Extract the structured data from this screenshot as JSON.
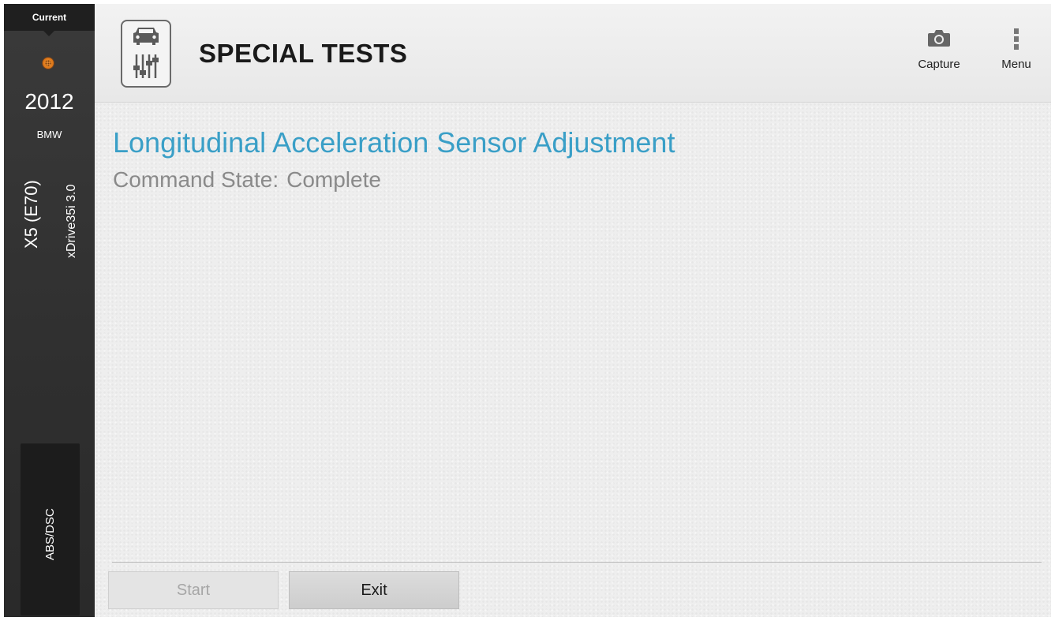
{
  "sidebar": {
    "current_label": "Current",
    "connector_icon": "obd-connector-icon",
    "year": "2012",
    "make": "BMW",
    "model": "X5 (E70)",
    "trim": "xDrive35i 3.0",
    "module": "ABS/DSC"
  },
  "header": {
    "app_icon": "special-tests-icon",
    "title": "SPECIAL TESTS",
    "capture_label": "Capture",
    "capture_icon": "camera-icon",
    "menu_label": "Menu",
    "menu_icon": "kebab-menu-icon"
  },
  "main": {
    "test_title": "Longitudinal Acceleration Sensor Adjustment",
    "command_state_label": "Command State:",
    "command_state_value": "Complete",
    "start_label": "Start",
    "start_enabled": false,
    "exit_label": "Exit"
  },
  "colors": {
    "accent": "#3a9fc7",
    "sidebar_bg": "#333333",
    "content_bg": "#eeeeee"
  }
}
